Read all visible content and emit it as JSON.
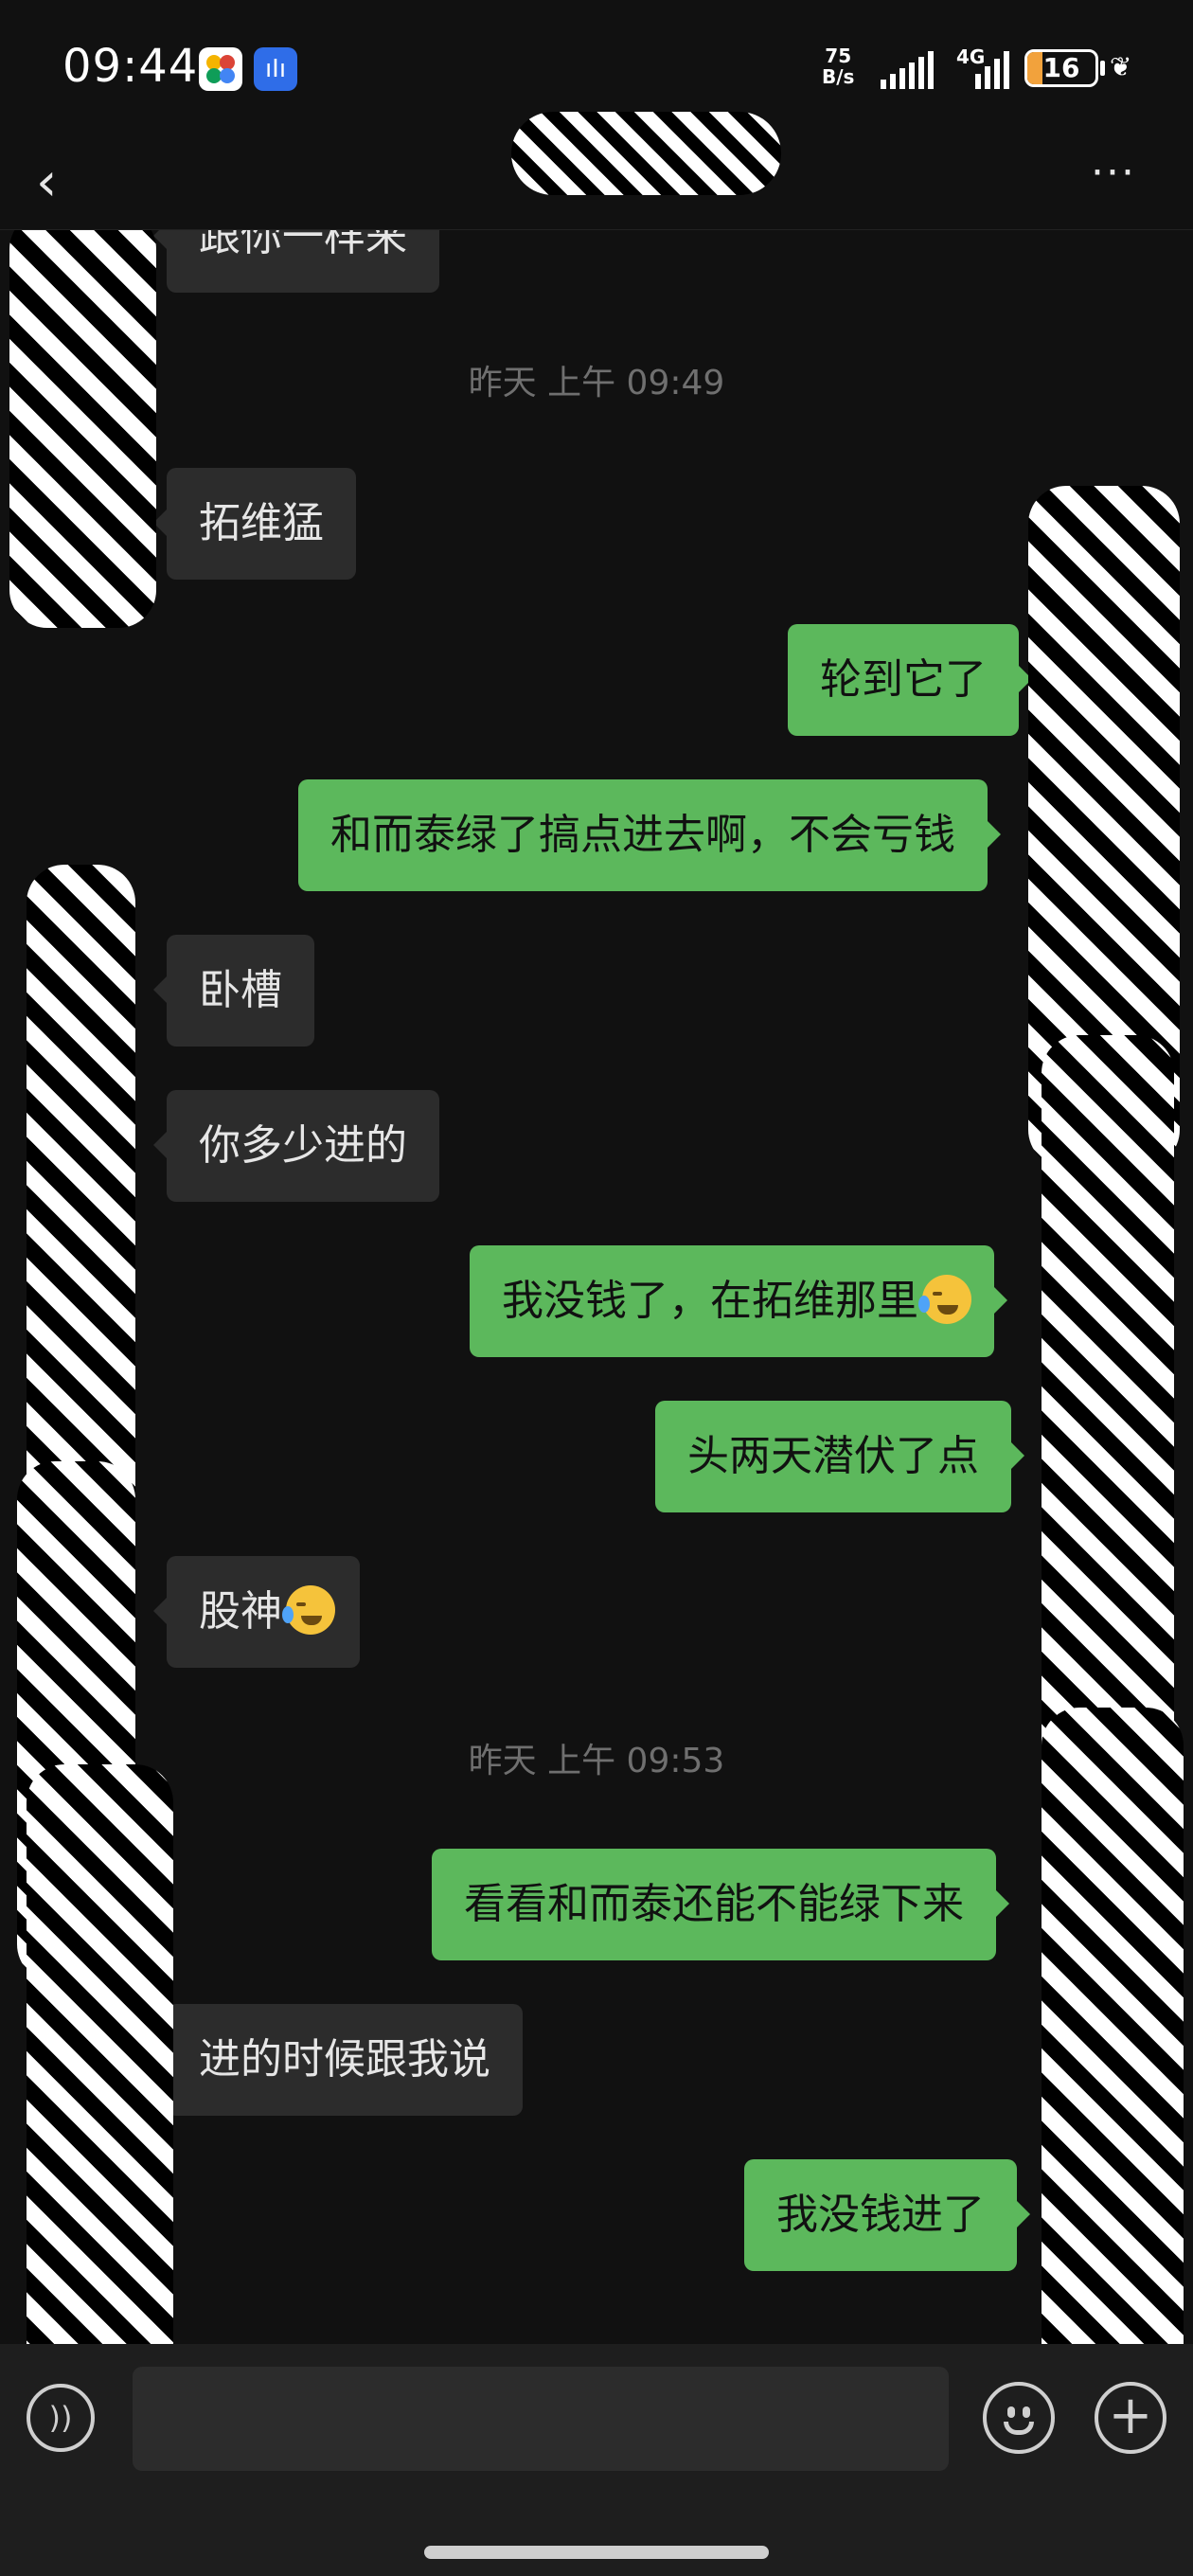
{
  "status_bar": {
    "time": "09:44",
    "net_speed_value": "75",
    "net_speed_unit": "B/s",
    "network_type": "4G",
    "battery_level": "16",
    "icons": [
      "photos-app-icon",
      "voice-recorder-icon",
      "signal-icon",
      "signal-4g-icon",
      "battery-icon",
      "leaf-icon"
    ]
  },
  "nav": {
    "back_icon": "‹",
    "more_icon": "···"
  },
  "messages": [
    {
      "side": "in",
      "text": "跟你一样来"
    },
    {
      "type": "timestamp",
      "text": "昨天 上午 09:49"
    },
    {
      "side": "in",
      "text": "拓维猛"
    },
    {
      "side": "out",
      "text": "轮到它了"
    },
    {
      "side": "out",
      "text": "和而泰绿了搞点进去啊，不会亏钱"
    },
    {
      "side": "in",
      "text": "卧槽"
    },
    {
      "side": "in",
      "text": "你多少进的"
    },
    {
      "side": "out",
      "text": "我没钱了，在拓维那里",
      "emoji": "crying-laughing-emoji"
    },
    {
      "side": "out",
      "text": "头两天潜伏了点"
    },
    {
      "side": "in",
      "text": "股神",
      "emoji": "crying-laughing-emoji"
    },
    {
      "type": "timestamp",
      "text": "昨天 上午 09:53"
    },
    {
      "side": "out",
      "text": "看看和而泰还能不能绿下来"
    },
    {
      "side": "in",
      "text": "进的时候跟我说"
    },
    {
      "side": "out",
      "text": "我没钱进了"
    }
  ],
  "input_bar": {
    "placeholder": "",
    "voice_icon": "voice-input-icon",
    "emoji_icon": "emoji-icon",
    "plus_icon": "+"
  },
  "colors": {
    "background": "#111111",
    "incoming_bubble": "#2c2c2c",
    "outgoing_bubble": "#5cb85c",
    "timestamp": "#6f6f6f"
  }
}
